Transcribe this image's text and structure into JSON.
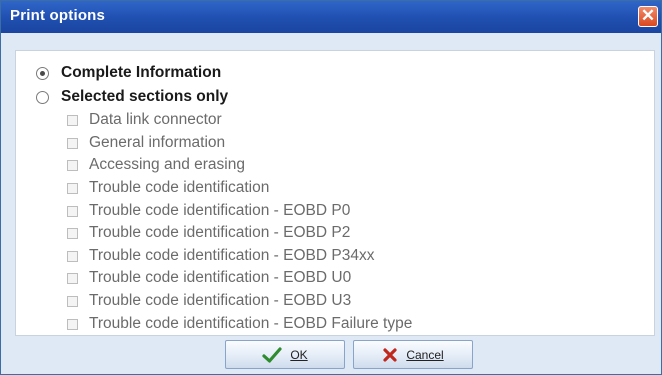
{
  "window": {
    "title": "Print options",
    "close_glyph": "✕"
  },
  "radios": [
    {
      "label": "Complete Information",
      "checked": true
    },
    {
      "label": "Selected sections only",
      "checked": false
    }
  ],
  "sections": [
    "Data link connector",
    "General information",
    "Accessing and erasing",
    "Trouble code identification",
    "Trouble code identification - EOBD P0",
    "Trouble code identification - EOBD P2",
    "Trouble code identification - EOBD P34xx",
    "Trouble code identification - EOBD U0",
    "Trouble code identification - EOBD U3",
    "Trouble code identification - EOBD Failure type"
  ],
  "buttons": {
    "ok_label": "OK",
    "cancel_label": "Cancel"
  },
  "icons": {
    "close": "close-icon",
    "ok": "checkmark-icon",
    "cancel": "x-icon"
  },
  "colors": {
    "titlebar": "#1f4fb0",
    "close_button": "#d9481f",
    "ok_check": "#2e8b2e",
    "cancel_x": "#c0281e",
    "disabled_text": "#6b6b6b"
  }
}
